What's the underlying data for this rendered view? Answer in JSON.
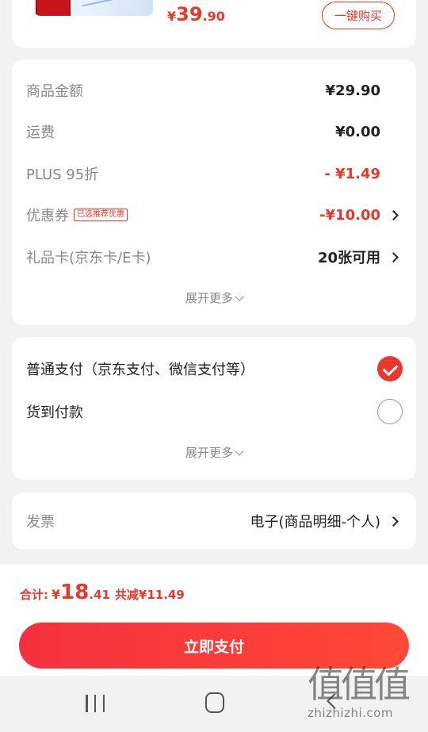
{
  "product": {
    "price_symbol": "¥",
    "price_int": "39",
    "price_dec": ".90",
    "buy_now_label": "一键购买"
  },
  "summary": {
    "rows": [
      {
        "label": "商品金额",
        "value": "¥29.90"
      },
      {
        "label": "运费",
        "value": "¥0.00"
      },
      {
        "label": "PLUS 95折",
        "value": "- ¥1.49"
      },
      {
        "label": "优惠券",
        "badge": "已选推荐优惠",
        "value": "-¥10.00"
      },
      {
        "label": "礼品卡(京东卡/E卡)",
        "value": "20张可用"
      }
    ],
    "expand_label": "展开更多"
  },
  "payment": {
    "options": [
      {
        "label": "普通支付（京东支付、微信支付等）",
        "selected": true
      },
      {
        "label": "货到付款",
        "selected": false
      }
    ],
    "expand_label": "展开更多"
  },
  "invoice": {
    "label": "发票",
    "value": "电子(商品明细-个人)"
  },
  "total": {
    "label": "合计:",
    "symbol": "¥",
    "int": "18",
    "dec": ".41",
    "saved": "共减¥11.49"
  },
  "pay_button_label": "立即支付",
  "watermark": {
    "big": "值值值",
    "small": "zhizhizhi.com"
  },
  "colors": {
    "accent": "#e8372b",
    "background": "#f2f2f2"
  }
}
